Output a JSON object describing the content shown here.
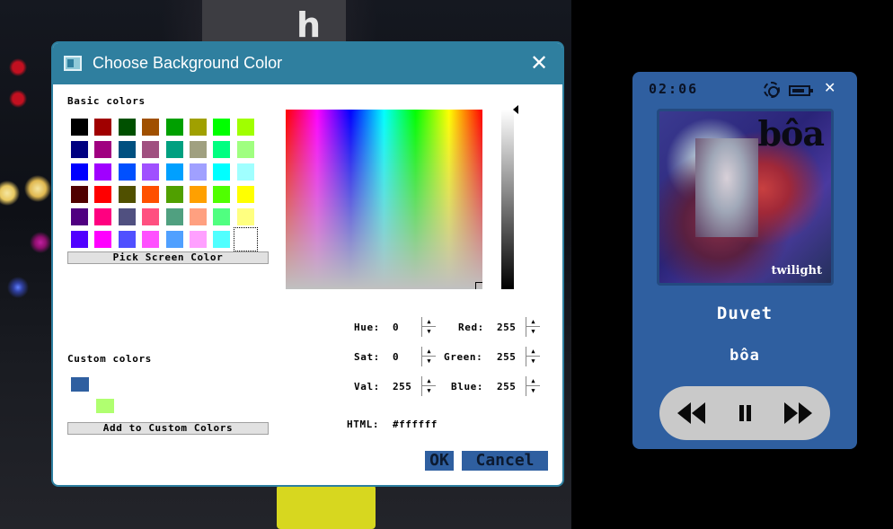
{
  "background": {
    "sign_glyph": "h"
  },
  "dialog": {
    "title": "Choose Background Color",
    "basic_colors_label": "Basic colors",
    "basic_colors": [
      "#000000",
      "#a00000",
      "#005000",
      "#a05000",
      "#00a000",
      "#a0a000",
      "#00ff00",
      "#a0ff00",
      "#000080",
      "#a00080",
      "#005080",
      "#a05080",
      "#00a080",
      "#a0a080",
      "#00ff80",
      "#a0ff80",
      "#0000ff",
      "#a000ff",
      "#0050ff",
      "#a050ff",
      "#00a0ff",
      "#a0a0ff",
      "#00ffff",
      "#a0ffff",
      "#500000",
      "#ff0000",
      "#505000",
      "#ff5000",
      "#50a000",
      "#ffa000",
      "#50ff00",
      "#ffff00",
      "#500080",
      "#ff0080",
      "#505080",
      "#ff5080",
      "#50a080",
      "#ffa080",
      "#50ff80",
      "#ffff80",
      "#5000ff",
      "#ff00ff",
      "#5050ff",
      "#ff50ff",
      "#50a0ff",
      "#ffa0ff",
      "#50ffff",
      "#ffffff"
    ],
    "selected_index": 47,
    "pick_screen_label": "Pick Screen Color",
    "custom_colors_label": "Custom colors",
    "custom_colors": [
      "#2f5fa0",
      "#b0ff70"
    ],
    "add_custom_label": "Add to Custom Colors",
    "fields": {
      "hue_label": "Hue:",
      "hue": "0",
      "sat_label": "Sat:",
      "sat": "0",
      "val_label": "Val:",
      "val": "255",
      "red_label": "Red:",
      "red": "255",
      "green_label": "Green:",
      "green": "255",
      "blue_label": "Blue:",
      "blue": "255",
      "html_label": "HTML:",
      "html": "#ffffff"
    },
    "ok_label": "OK",
    "cancel_label": "Cancel"
  },
  "player": {
    "time": "02:06",
    "album_brand": "bôa",
    "album_subtitle": "twilight",
    "song_title": "Duvet",
    "artist": "bôa",
    "accent_color": "#2f5fa0"
  }
}
